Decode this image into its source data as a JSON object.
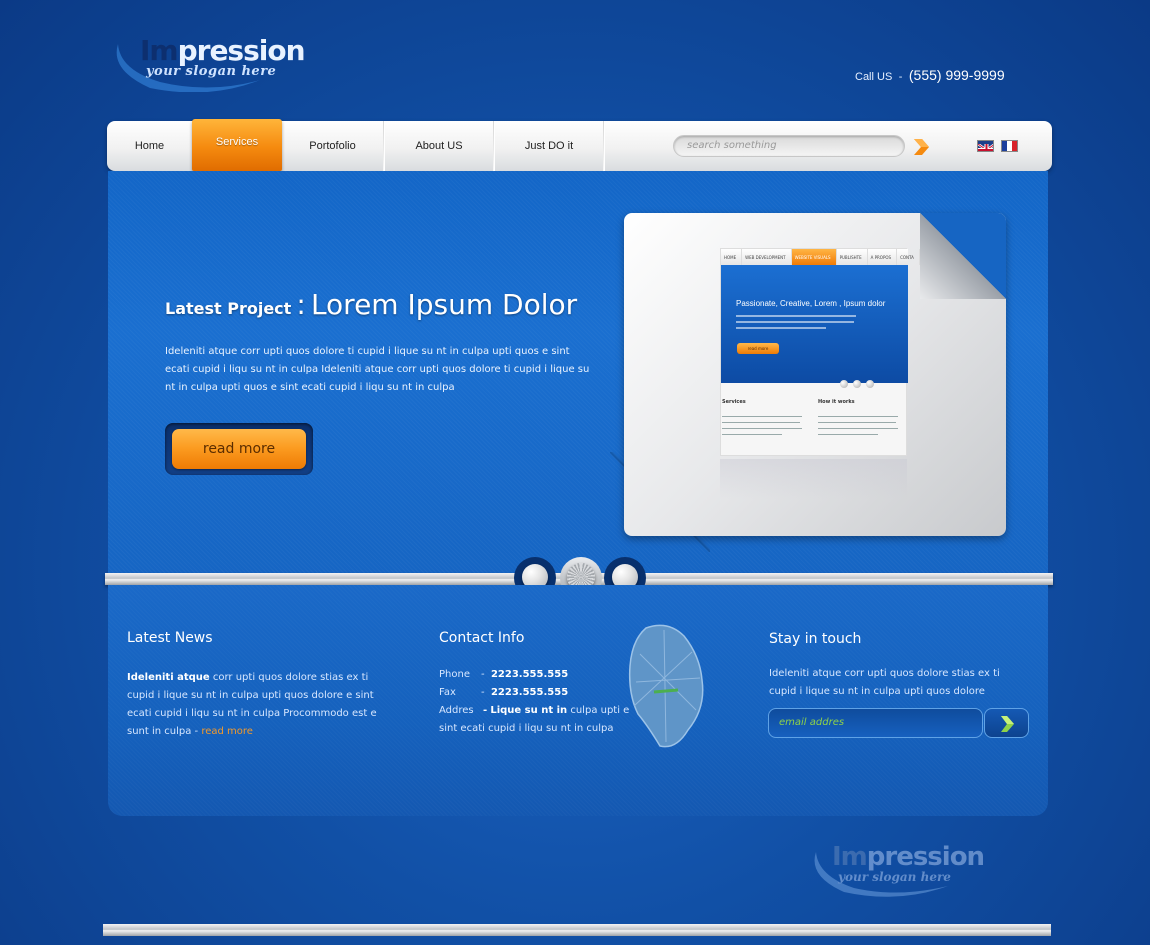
{
  "brand": {
    "logo_word_a": "Im",
    "logo_word_b": "pression",
    "slogan": "your slogan here"
  },
  "contact_header": {
    "label": "Call US",
    "separator": "-",
    "phone": "(555) 999-9999"
  },
  "nav": {
    "items": [
      "Home",
      "Services",
      "Portofolio",
      "About US",
      "Just DO it"
    ],
    "active": "Services",
    "search_placeholder": "search something",
    "languages": [
      "English",
      "Français"
    ]
  },
  "hero": {
    "label": "Latest Project",
    "separator": ":",
    "title": "Lorem Ipsum Dolor",
    "text": "Ideleniti  atque  corr  upti  quos  dolore ti cupid i lique su nt in culpa upti  quos e sint  ecati cupid i liqu su nt in culpa Ideleniti  atque  corr  upti  quos  dolore ti cupid i lique su nt in culpa upti  quos e sint  ecati cupid i liqu su nt in culpa",
    "button": "read more",
    "preview": {
      "nav": [
        "HOME",
        "WEB DEVELOPMENT",
        "WEBSITE VISUALS",
        "PUBLISHTE",
        "A PROPOS",
        "CONTA"
      ],
      "headline": "Passionate, Creative, Lorem , Ipsum dolor",
      "button": "read more",
      "col1": "Services",
      "col2": "How it works"
    }
  },
  "slider": {
    "count": 3,
    "active_index": 1
  },
  "news": {
    "title": "Latest News",
    "bold_lead": "Ideleniti  atque",
    "text": " corr  upti  quos  dolore  stias ex ti cupid i lique su nt in culpa upti  quos  dolore e sint  ecati cupid i liqu su nt in culpa Procommodo  est e sunt  in culpa - ",
    "link": "read more"
  },
  "contact": {
    "title": "Contact Info",
    "phone_label": "Phone",
    "phone": "2223.555.555",
    "fax_label": "Fax",
    "fax": "2223.555.555",
    "address_label": "Addres",
    "address_bold": "Lique su nt in",
    "address_rest": " culpa upti e sint  ecati cupid i liqu su nt in culpa",
    "dash": "-"
  },
  "stay": {
    "title": "Stay in touch",
    "text": "Ideleniti  atque  corr  upti  quos  dolore  stias ex ti cupid i lique su nt in culpa upti  quos  dolore",
    "email_placeholder": "email addres"
  },
  "footer": {
    "logo_word_a": "Im",
    "logo_word_b": "pression",
    "slogan": "your slogan here"
  },
  "colors": {
    "accent_orange": "#f58a0f",
    "bg_blue": "#1150a6",
    "link_orange": "#f39a2a",
    "placeholder_green": "#8fd24a"
  }
}
